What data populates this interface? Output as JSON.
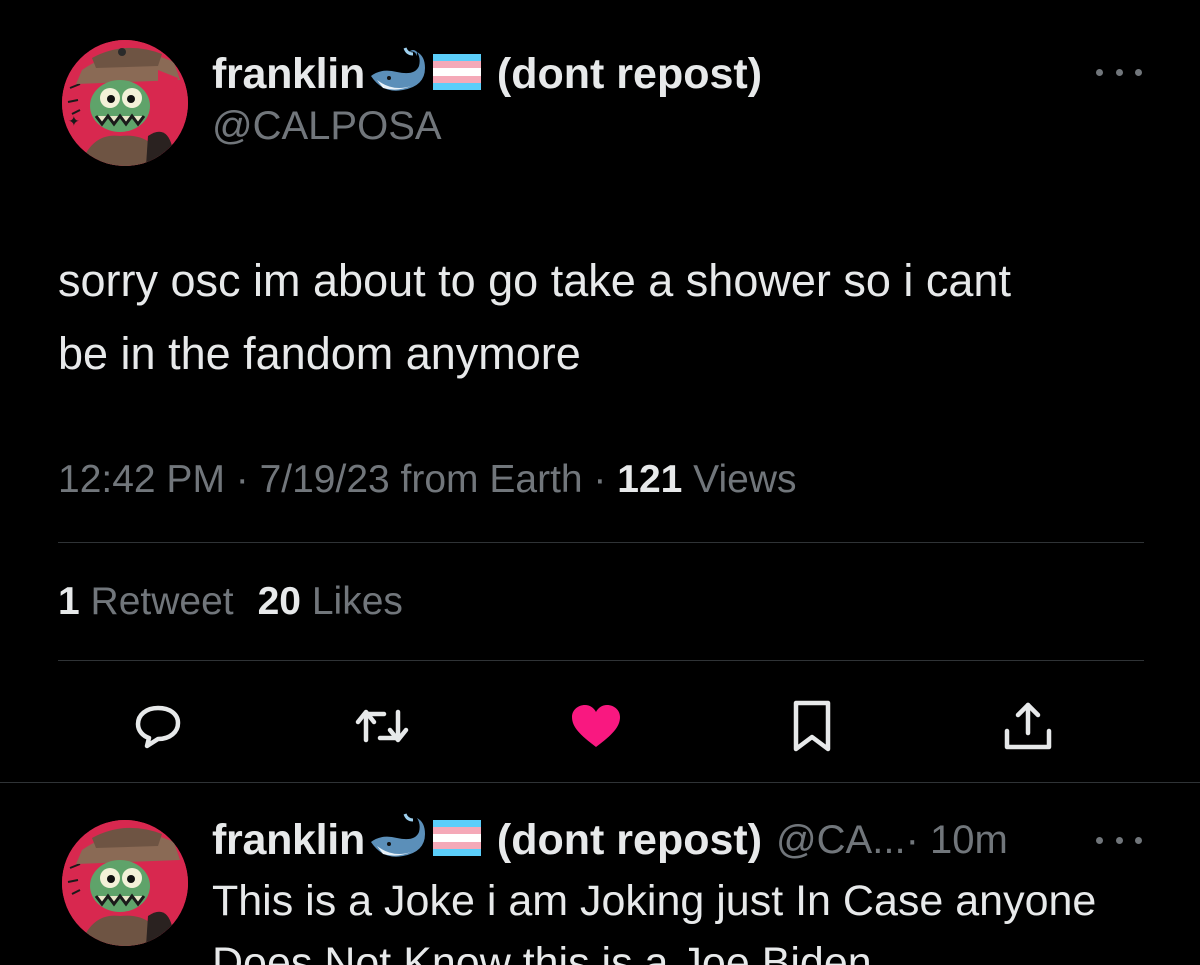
{
  "colors": {
    "background": "#000000",
    "text": "#e7e9ea",
    "secondary": "#71767b",
    "divider": "#2f3336",
    "like_active": "#f91880",
    "avatar_bg": "#d8284f"
  },
  "main_tweet": {
    "author": {
      "display_name": "franklin",
      "emojis": [
        "whale-emoji",
        "transgender-flag-emoji"
      ],
      "display_suffix": "(dont repost)",
      "handle": "@CALPOSA"
    },
    "text_line1": "sorry osc im about to go take a shower so i cant",
    "text_line2": "be in the fandom anymore",
    "timestamp": "12:42 PM · 7/19/23 from Earth · ",
    "views_count": "121",
    "views_label": " Views",
    "retweets_count": "1",
    "retweets_label": " Retweet",
    "likes_count": "20",
    "likes_label": " Likes",
    "actions": [
      "reply-icon",
      "retweet-icon",
      "like-icon",
      "bookmark-icon",
      "share-icon"
    ],
    "liked": true
  },
  "reply_tweet": {
    "author": {
      "display_name": "franklin",
      "display_suffix": "(dont repost)",
      "handle": "@CA...",
      "time": " · 10m"
    },
    "text_line1": "This is a Joke i am Joking just In Case anyone",
    "text_line2": "Does Not Know this is a Joe Biden"
  }
}
